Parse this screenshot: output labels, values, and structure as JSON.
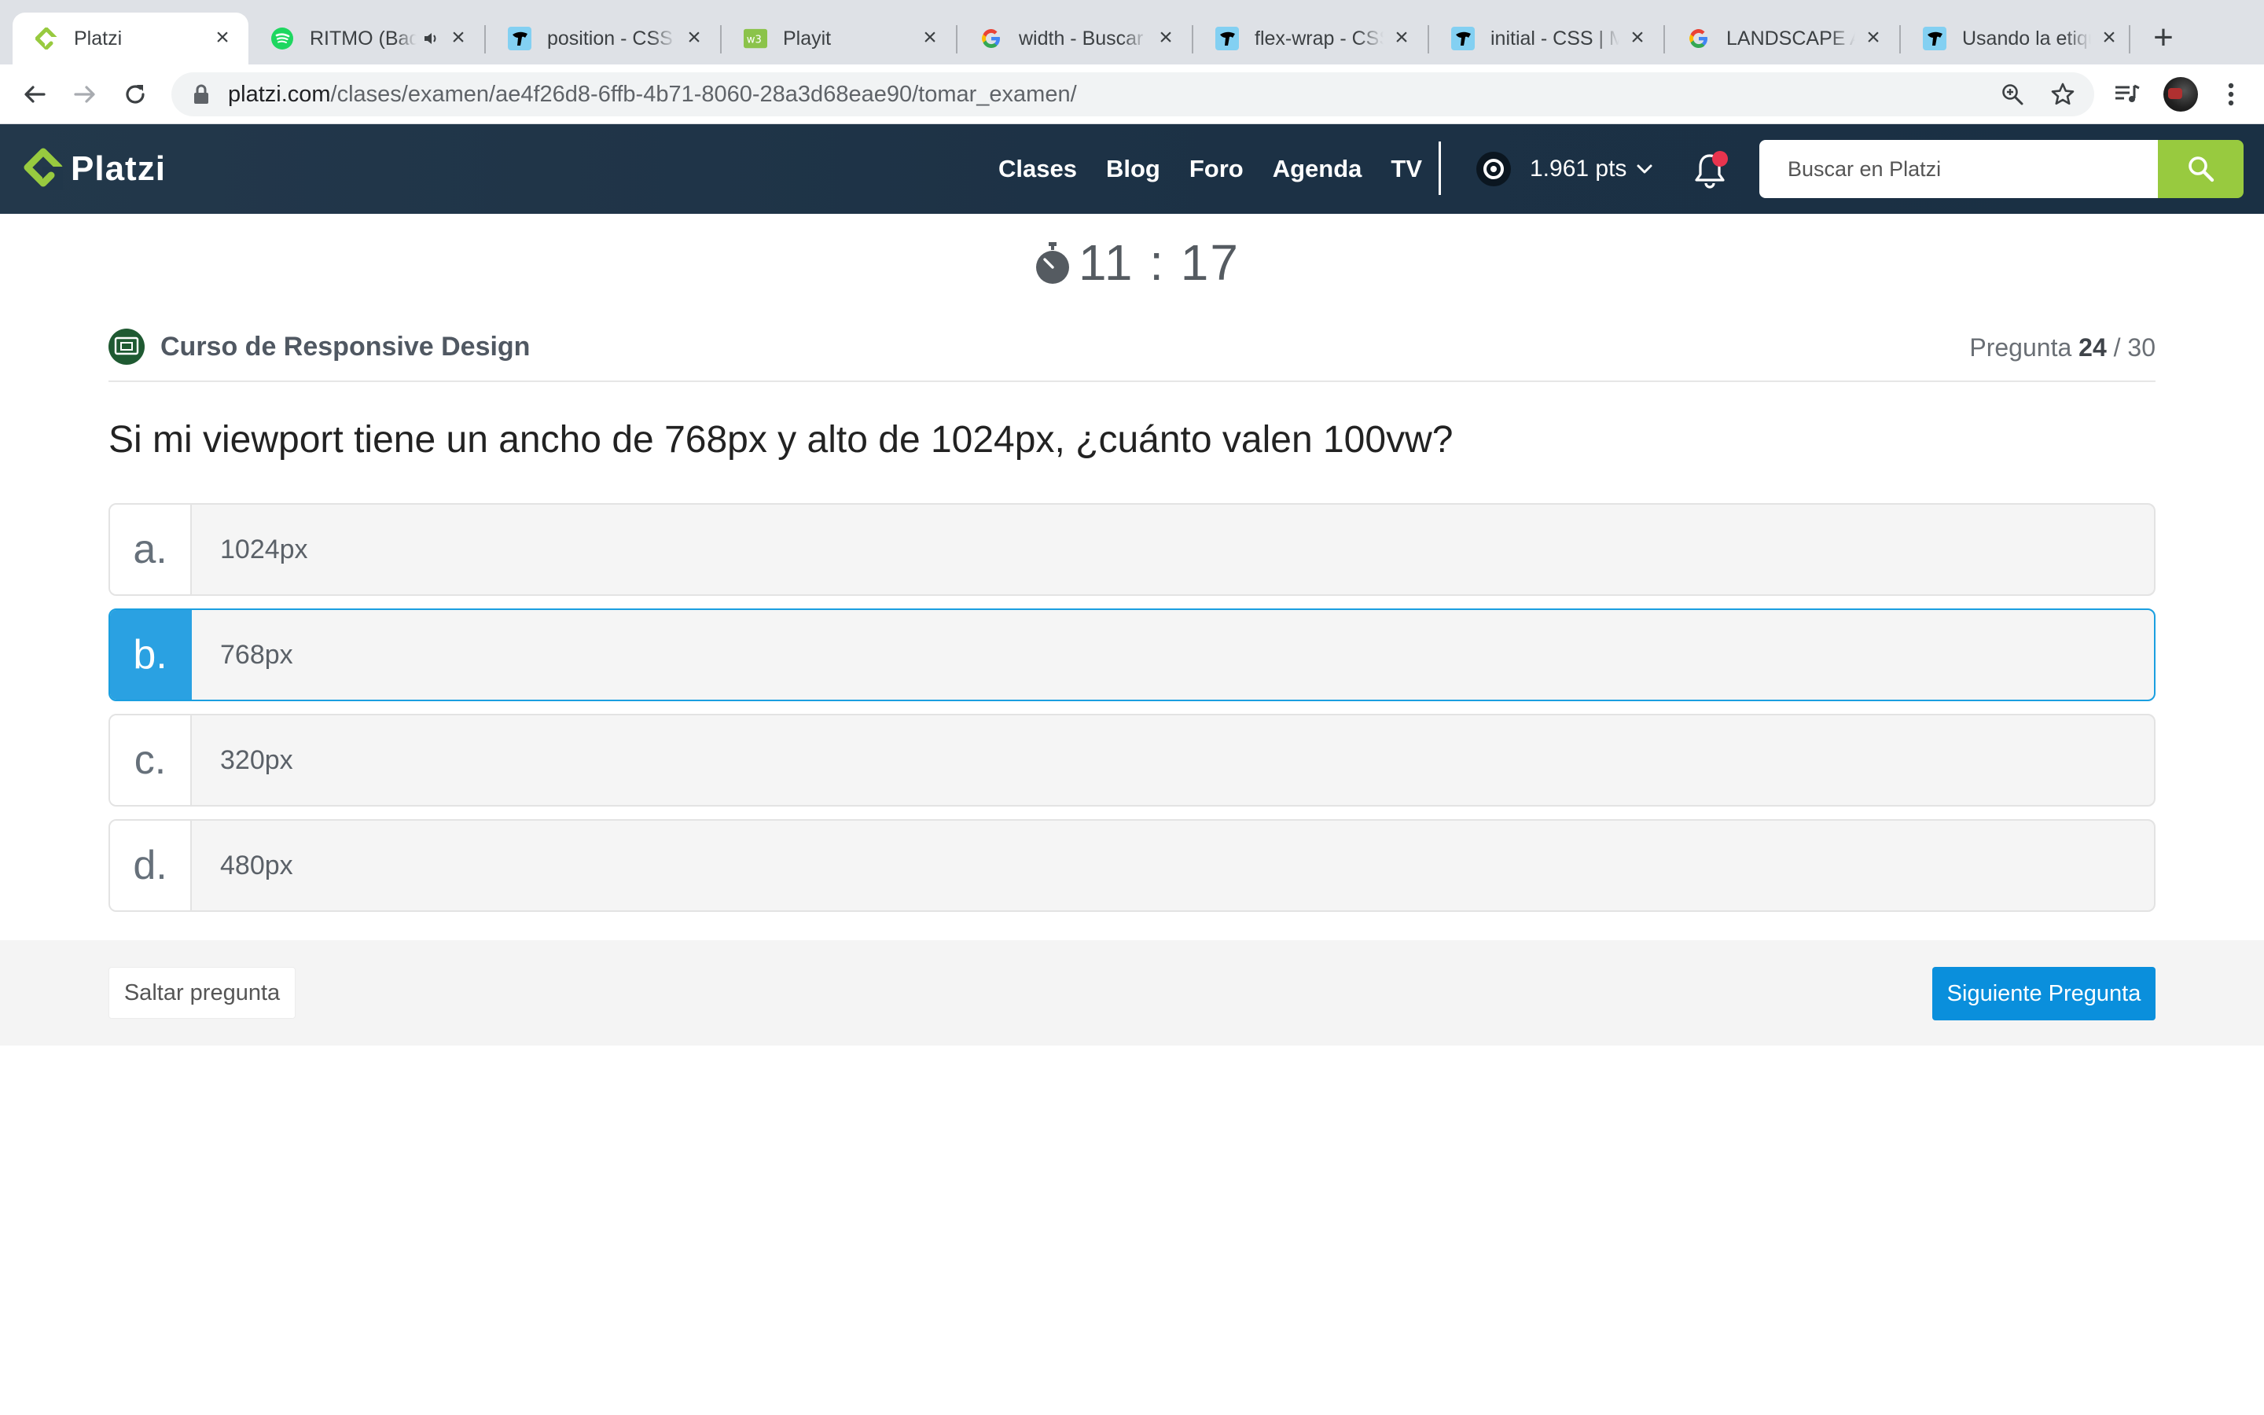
{
  "browser": {
    "tabs": [
      {
        "title": "Platzi",
        "icon": "platzi-icon",
        "active": true
      },
      {
        "title": "RITMO (Bad Boys For Life)",
        "icon": "spotify-icon",
        "audio": true
      },
      {
        "title": "position - CSS | MDN",
        "icon": "mdn-icon"
      },
      {
        "title": "Playit",
        "icon": "playit-icon"
      },
      {
        "title": "width - Buscar con Google",
        "icon": "google-icon"
      },
      {
        "title": "flex-wrap - CSS | MDN",
        "icon": "mdn-icon"
      },
      {
        "title": "initial - CSS | MDN",
        "icon": "mdn-icon"
      },
      {
        "title": "LANDSCAPE AND PORTRAIT",
        "icon": "google-icon"
      },
      {
        "title": "Usando la etiqueta viewport",
        "icon": "mdn-icon"
      }
    ],
    "url_host": "platzi.com",
    "url_path": "/clases/examen/ae4f26d8-6ffb-4b71-8060-28a3d68eae90/tomar_examen/"
  },
  "header": {
    "logo_text": "Platzi",
    "nav": [
      "Clases",
      "Blog",
      "Foro",
      "Agenda",
      "TV"
    ],
    "points": "1.961 pts",
    "search_placeholder": "Buscar en Platzi",
    "accent_green": "#98ca3f",
    "notification_color": "#e8344e"
  },
  "exam": {
    "timer": "11 : 17",
    "course": "Curso de Responsive Design",
    "question_label": "Pregunta",
    "question_current": "24",
    "question_total": "/ 30",
    "question": "Si mi viewport tiene un ancho de 768px y alto de 1024px, ¿cuánto valen 100vw?",
    "answers": [
      {
        "letter": "a.",
        "text": "1024px",
        "selected": false
      },
      {
        "letter": "b.",
        "text": "768px",
        "selected": true
      },
      {
        "letter": "c.",
        "text": "320px",
        "selected": false
      },
      {
        "letter": "d.",
        "text": "480px",
        "selected": false
      }
    ],
    "skip_label": "Saltar pregunta",
    "next_label": "Siguiente Pregunta",
    "selected_color": "#2aa1e2"
  }
}
